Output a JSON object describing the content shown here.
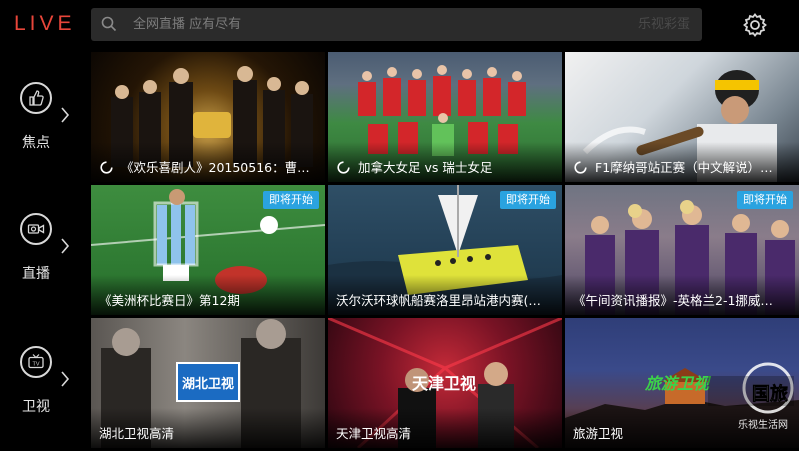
{
  "app": {
    "logo": "LIVE"
  },
  "search": {
    "placeholder": "全网直播 应有尽有",
    "hint": "乐视彩蛋"
  },
  "sidebar": {
    "items": [
      {
        "label": "焦点",
        "icon": "focus-icon"
      },
      {
        "label": "直播",
        "icon": "camera-icon"
      },
      {
        "label": "卫视",
        "icon": "tv-icon"
      }
    ]
  },
  "tiles": [
    {
      "title": "《欢乐喜剧人》20150516：曹…",
      "live": true,
      "badge": ""
    },
    {
      "title": "加拿大女足 vs 瑞士女足",
      "live": true,
      "badge": ""
    },
    {
      "title": "F1摩纳哥站正赛（中文解说）…",
      "live": true,
      "badge": ""
    },
    {
      "title": "《美洲杯比赛日》第12期",
      "live": false,
      "badge": "即将开始"
    },
    {
      "title": "沃尔沃环球帆船赛洛里昂站港内赛(…",
      "live": false,
      "badge": "即将开始"
    },
    {
      "title": "《午间资讯播报》-英格兰2-1挪威…",
      "live": false,
      "badge": "即将开始"
    },
    {
      "title": "湖北卫视高清",
      "live": false,
      "badge": "",
      "channel_logo": "湖北卫视"
    },
    {
      "title": "天津卫视高清",
      "live": false,
      "badge": "",
      "channel_logo": "天津卫视"
    },
    {
      "title": "旅游卫视",
      "live": false,
      "badge": "",
      "channel_logo": "旅游卫视"
    }
  ],
  "watermark": {
    "text": "国旅",
    "sub": "乐视生活网"
  },
  "colors": {
    "accent": "#e8463a",
    "badge": "#2aa3e0"
  }
}
